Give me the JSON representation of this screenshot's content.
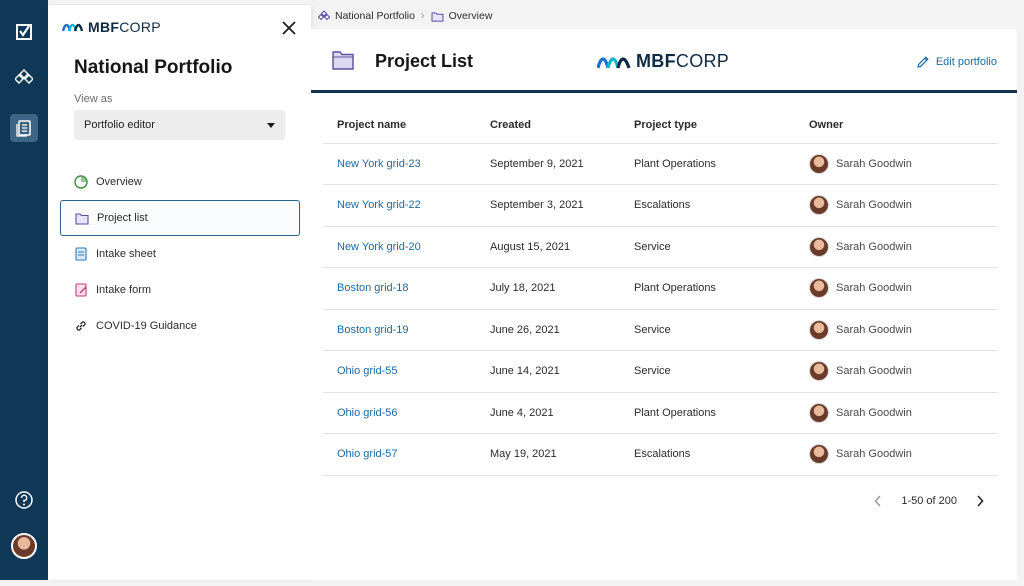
{
  "brand": {
    "name_bold": "MBF",
    "name_light": "CORP"
  },
  "panel": {
    "title": "National Portfolio",
    "view_as_label": "View as",
    "role": "Portfolio editor",
    "nav": [
      {
        "label": "Overview",
        "icon": "pie-chart-icon"
      },
      {
        "label": "Project list",
        "icon": "folder-icon"
      },
      {
        "label": "Intake sheet",
        "icon": "sheet-icon"
      },
      {
        "label": "Intake form",
        "icon": "form-icon"
      },
      {
        "label": "COVID-19 Guidance",
        "icon": "link-icon"
      }
    ]
  },
  "breadcrumb": {
    "items": [
      "National Portfolio",
      "Overview"
    ]
  },
  "main": {
    "title": "Project List",
    "edit_label": "Edit portfolio",
    "columns": [
      "Project name",
      "Created",
      "Project type",
      "Owner"
    ],
    "rows": [
      {
        "name": "New York grid-23",
        "created": "September 9, 2021",
        "type": "Plant Operations",
        "owner": "Sarah Goodwin"
      },
      {
        "name": "New York grid-22",
        "created": "September 3, 2021",
        "type": "Escalations",
        "owner": "Sarah Goodwin"
      },
      {
        "name": "New York grid-20",
        "created": "August 15, 2021",
        "type": "Service",
        "owner": "Sarah Goodwin"
      },
      {
        "name": "Boston grid-18",
        "created": "July 18, 2021",
        "type": "Plant Operations",
        "owner": "Sarah Goodwin"
      },
      {
        "name": "Boston grid-19",
        "created": "June 26, 2021",
        "type": "Service",
        "owner": "Sarah Goodwin"
      },
      {
        "name": "Ohio grid-55",
        "created": "June 14, 2021",
        "type": "Service",
        "owner": "Sarah Goodwin"
      },
      {
        "name": "Ohio grid-56",
        "created": "June 4, 2021",
        "type": "Plant Operations",
        "owner": "Sarah Goodwin"
      },
      {
        "name": "Ohio grid-57",
        "created": "May 19, 2021",
        "type": "Escalations",
        "owner": "Sarah Goodwin"
      }
    ],
    "pagination": "1-50 of 200"
  },
  "colors": {
    "rail": "#0f3756",
    "accent": "#1e6aa0",
    "brand_blue": "#1a6fd1",
    "brand_teal": "#12b5c9"
  }
}
